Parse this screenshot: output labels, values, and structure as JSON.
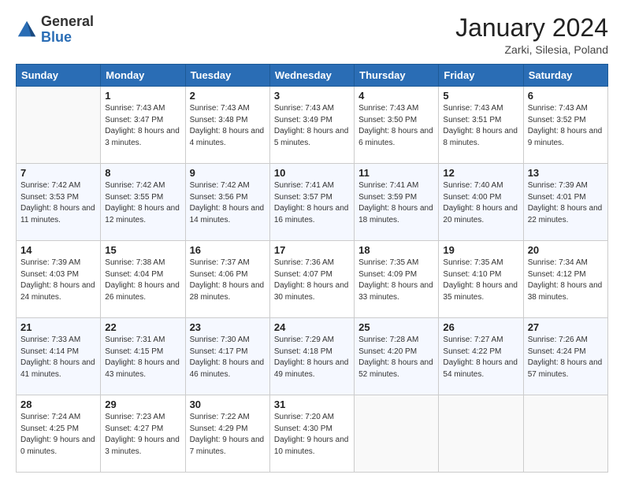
{
  "header": {
    "logo_line1": "General",
    "logo_line2": "Blue",
    "month_year": "January 2024",
    "location": "Zarki, Silesia, Poland"
  },
  "days_of_week": [
    "Sunday",
    "Monday",
    "Tuesday",
    "Wednesday",
    "Thursday",
    "Friday",
    "Saturday"
  ],
  "weeks": [
    [
      {
        "day": "",
        "sunrise": "",
        "sunset": "",
        "daylight": ""
      },
      {
        "day": "1",
        "sunrise": "Sunrise: 7:43 AM",
        "sunset": "Sunset: 3:47 PM",
        "daylight": "Daylight: 8 hours and 3 minutes."
      },
      {
        "day": "2",
        "sunrise": "Sunrise: 7:43 AM",
        "sunset": "Sunset: 3:48 PM",
        "daylight": "Daylight: 8 hours and 4 minutes."
      },
      {
        "day": "3",
        "sunrise": "Sunrise: 7:43 AM",
        "sunset": "Sunset: 3:49 PM",
        "daylight": "Daylight: 8 hours and 5 minutes."
      },
      {
        "day": "4",
        "sunrise": "Sunrise: 7:43 AM",
        "sunset": "Sunset: 3:50 PM",
        "daylight": "Daylight: 8 hours and 6 minutes."
      },
      {
        "day": "5",
        "sunrise": "Sunrise: 7:43 AM",
        "sunset": "Sunset: 3:51 PM",
        "daylight": "Daylight: 8 hours and 8 minutes."
      },
      {
        "day": "6",
        "sunrise": "Sunrise: 7:43 AM",
        "sunset": "Sunset: 3:52 PM",
        "daylight": "Daylight: 8 hours and 9 minutes."
      }
    ],
    [
      {
        "day": "7",
        "sunrise": "Sunrise: 7:42 AM",
        "sunset": "Sunset: 3:53 PM",
        "daylight": "Daylight: 8 hours and 11 minutes."
      },
      {
        "day": "8",
        "sunrise": "Sunrise: 7:42 AM",
        "sunset": "Sunset: 3:55 PM",
        "daylight": "Daylight: 8 hours and 12 minutes."
      },
      {
        "day": "9",
        "sunrise": "Sunrise: 7:42 AM",
        "sunset": "Sunset: 3:56 PM",
        "daylight": "Daylight: 8 hours and 14 minutes."
      },
      {
        "day": "10",
        "sunrise": "Sunrise: 7:41 AM",
        "sunset": "Sunset: 3:57 PM",
        "daylight": "Daylight: 8 hours and 16 minutes."
      },
      {
        "day": "11",
        "sunrise": "Sunrise: 7:41 AM",
        "sunset": "Sunset: 3:59 PM",
        "daylight": "Daylight: 8 hours and 18 minutes."
      },
      {
        "day": "12",
        "sunrise": "Sunrise: 7:40 AM",
        "sunset": "Sunset: 4:00 PM",
        "daylight": "Daylight: 8 hours and 20 minutes."
      },
      {
        "day": "13",
        "sunrise": "Sunrise: 7:39 AM",
        "sunset": "Sunset: 4:01 PM",
        "daylight": "Daylight: 8 hours and 22 minutes."
      }
    ],
    [
      {
        "day": "14",
        "sunrise": "Sunrise: 7:39 AM",
        "sunset": "Sunset: 4:03 PM",
        "daylight": "Daylight: 8 hours and 24 minutes."
      },
      {
        "day": "15",
        "sunrise": "Sunrise: 7:38 AM",
        "sunset": "Sunset: 4:04 PM",
        "daylight": "Daylight: 8 hours and 26 minutes."
      },
      {
        "day": "16",
        "sunrise": "Sunrise: 7:37 AM",
        "sunset": "Sunset: 4:06 PM",
        "daylight": "Daylight: 8 hours and 28 minutes."
      },
      {
        "day": "17",
        "sunrise": "Sunrise: 7:36 AM",
        "sunset": "Sunset: 4:07 PM",
        "daylight": "Daylight: 8 hours and 30 minutes."
      },
      {
        "day": "18",
        "sunrise": "Sunrise: 7:35 AM",
        "sunset": "Sunset: 4:09 PM",
        "daylight": "Daylight: 8 hours and 33 minutes."
      },
      {
        "day": "19",
        "sunrise": "Sunrise: 7:35 AM",
        "sunset": "Sunset: 4:10 PM",
        "daylight": "Daylight: 8 hours and 35 minutes."
      },
      {
        "day": "20",
        "sunrise": "Sunrise: 7:34 AM",
        "sunset": "Sunset: 4:12 PM",
        "daylight": "Daylight: 8 hours and 38 minutes."
      }
    ],
    [
      {
        "day": "21",
        "sunrise": "Sunrise: 7:33 AM",
        "sunset": "Sunset: 4:14 PM",
        "daylight": "Daylight: 8 hours and 41 minutes."
      },
      {
        "day": "22",
        "sunrise": "Sunrise: 7:31 AM",
        "sunset": "Sunset: 4:15 PM",
        "daylight": "Daylight: 8 hours and 43 minutes."
      },
      {
        "day": "23",
        "sunrise": "Sunrise: 7:30 AM",
        "sunset": "Sunset: 4:17 PM",
        "daylight": "Daylight: 8 hours and 46 minutes."
      },
      {
        "day": "24",
        "sunrise": "Sunrise: 7:29 AM",
        "sunset": "Sunset: 4:18 PM",
        "daylight": "Daylight: 8 hours and 49 minutes."
      },
      {
        "day": "25",
        "sunrise": "Sunrise: 7:28 AM",
        "sunset": "Sunset: 4:20 PM",
        "daylight": "Daylight: 8 hours and 52 minutes."
      },
      {
        "day": "26",
        "sunrise": "Sunrise: 7:27 AM",
        "sunset": "Sunset: 4:22 PM",
        "daylight": "Daylight: 8 hours and 54 minutes."
      },
      {
        "day": "27",
        "sunrise": "Sunrise: 7:26 AM",
        "sunset": "Sunset: 4:24 PM",
        "daylight": "Daylight: 8 hours and 57 minutes."
      }
    ],
    [
      {
        "day": "28",
        "sunrise": "Sunrise: 7:24 AM",
        "sunset": "Sunset: 4:25 PM",
        "daylight": "Daylight: 9 hours and 0 minutes."
      },
      {
        "day": "29",
        "sunrise": "Sunrise: 7:23 AM",
        "sunset": "Sunset: 4:27 PM",
        "daylight": "Daylight: 9 hours and 3 minutes."
      },
      {
        "day": "30",
        "sunrise": "Sunrise: 7:22 AM",
        "sunset": "Sunset: 4:29 PM",
        "daylight": "Daylight: 9 hours and 7 minutes."
      },
      {
        "day": "31",
        "sunrise": "Sunrise: 7:20 AM",
        "sunset": "Sunset: 4:30 PM",
        "daylight": "Daylight: 9 hours and 10 minutes."
      },
      {
        "day": "",
        "sunrise": "",
        "sunset": "",
        "daylight": ""
      },
      {
        "day": "",
        "sunrise": "",
        "sunset": "",
        "daylight": ""
      },
      {
        "day": "",
        "sunrise": "",
        "sunset": "",
        "daylight": ""
      }
    ]
  ]
}
